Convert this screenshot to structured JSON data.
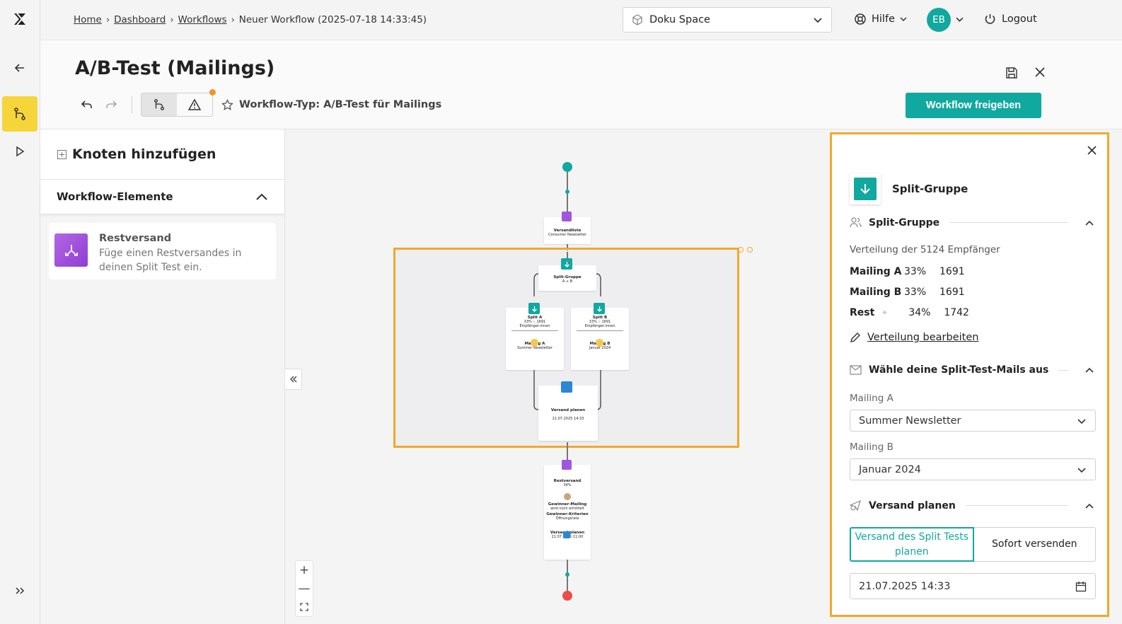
{
  "breadcrumb": {
    "home": "Home",
    "dashboard": "Dashboard",
    "workflows": "Workflows",
    "current": "Neuer Workflow (2025-07-18 14:33:45)"
  },
  "topbar": {
    "space": "Doku Space",
    "help": "Hilfe",
    "avatar": "EB",
    "logout": "Logout"
  },
  "header": {
    "title": "A/B-Test (Mailings)",
    "workflow_type": "Workflow-Typ: A/B-Test für Mailings",
    "release_button": "Workflow freigeben"
  },
  "left_panel": {
    "title": "Knoten hinzufügen",
    "section": "Workflow-Elemente",
    "items": [
      {
        "title": "Restversand",
        "description": "Füge einen Restversandes in deinen Split Test ein."
      }
    ]
  },
  "canvas": {
    "nodes": {
      "recipients": {
        "title": "Versandliste",
        "sub": "Consumer Newsletter"
      },
      "split_group": {
        "title": "Split-Gruppe",
        "sub": "A + B"
      },
      "split_a": {
        "title": "Split A",
        "line1": "33% :: 1691",
        "line2": "Empfänger:innen",
        "mail_title": "Mailing A",
        "mail_sub": "Summer Newsletter"
      },
      "split_b": {
        "title": "Split B",
        "line1": "33% :: 1691",
        "line2": "Empfänger:innen",
        "mail_title": "Mailing B",
        "mail_sub": "Januar 2024"
      },
      "schedule": {
        "title": "Versand planen",
        "sub": "21.07.2025 14:33"
      },
      "rest": {
        "title": "Restversand",
        "percent": "34%",
        "winner_mail": "Gewinner-Mailing",
        "winner_mail_sub": "wird noch ermittelt",
        "winner_criteria": "Gewinner-Kriterien",
        "winner_criteria_sub": "Öffnungsrate",
        "schedule": "Versand planen",
        "schedule_date": "21.07.2025 11:00"
      }
    },
    "zoom_in": "+",
    "zoom_out": "—"
  },
  "right_panel": {
    "node_title": "Split-Gruppe",
    "section_split": "Split-Gruppe",
    "distribution_label": "Verteilung der 5124 Empfänger",
    "distribution": [
      {
        "name": "Mailing A",
        "percent": "33%",
        "count": "1691"
      },
      {
        "name": "Mailing B",
        "percent": "33%",
        "count": "1691"
      },
      {
        "name": "Rest",
        "percent": "34%",
        "count": "1742"
      }
    ],
    "edit_link": "Verteilung bearbeiten",
    "section_mails": "Wähle deine Split-Test-Mails aus",
    "mailing_a_label": "Mailing A",
    "mailing_a_value": "Summer Newsletter",
    "mailing_b_label": "Mailing B",
    "mailing_b_value": "Januar 2024",
    "section_schedule": "Versand planen",
    "toggle_plan": "Versand des Split Tests planen",
    "toggle_now": "Sofort versenden",
    "date_value": "21.07.2025 14:33"
  },
  "colors": {
    "accent": "#11a89f",
    "highlight": "#f0a92a",
    "active_rail": "#f5d53a",
    "notify": "#f39322"
  }
}
